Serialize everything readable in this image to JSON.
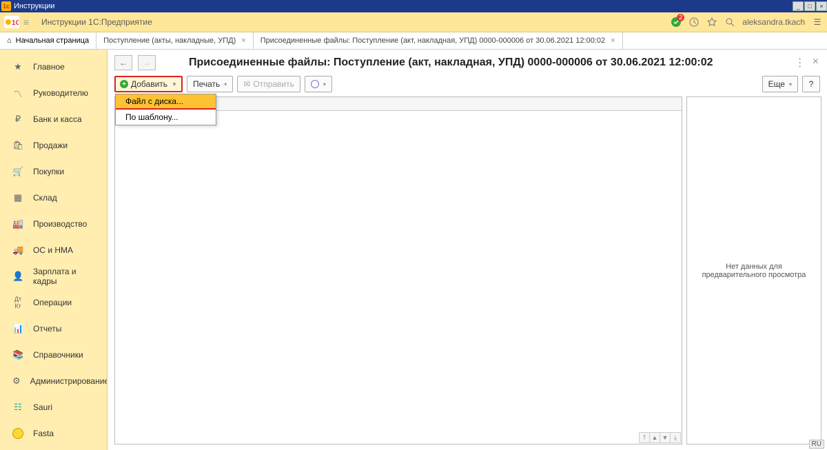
{
  "titlebar": {
    "text": "Инструкции"
  },
  "appbar": {
    "title": "Инструкции 1С:Предприятие",
    "badge": "2",
    "username": "aleksandra.tkach"
  },
  "tabs": {
    "home": "Начальная страница",
    "t1": "Поступление (акты, накладные, УПД)",
    "t2": "Присоединенные файлы: Поступление (акт, накладная, УПД) 0000-000006 от 30.06.2021 12:00:02"
  },
  "sidebar": {
    "items": [
      {
        "label": "Главное"
      },
      {
        "label": "Руководителю"
      },
      {
        "label": "Банк и касса"
      },
      {
        "label": "Продажи"
      },
      {
        "label": "Покупки"
      },
      {
        "label": "Склад"
      },
      {
        "label": "Производство"
      },
      {
        "label": "ОС и НМА"
      },
      {
        "label": "Зарплата и кадры"
      },
      {
        "label": "Операции"
      },
      {
        "label": "Отчеты"
      },
      {
        "label": "Справочники"
      },
      {
        "label": "Администрирование"
      },
      {
        "label": "Sauri"
      },
      {
        "label": "Fasta"
      }
    ]
  },
  "page": {
    "title": "Присоединенные файлы: Поступление (акт, накладная, УПД) 0000-000006 от 30.06.2021 12:00:02"
  },
  "toolbar": {
    "add": "Добавить",
    "print": "Печать",
    "send": "Отправить",
    "more": "Еще",
    "help": "?"
  },
  "dropdown": {
    "fromdisk": "Файл с диска...",
    "fromtpl": "По шаблону..."
  },
  "preview": {
    "empty": "Нет данных для предварительного просмотра"
  },
  "lang": "RU"
}
